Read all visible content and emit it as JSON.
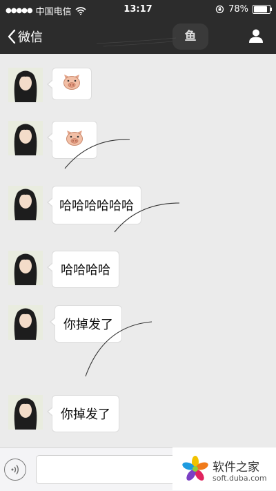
{
  "status_bar": {
    "signal_dots": "●●●●●",
    "carrier": "中国电信",
    "time": "13:17",
    "battery_percent": "78%",
    "battery_level": 0.78
  },
  "nav": {
    "back_label": "微信",
    "title_fragment": "鱼"
  },
  "messages": [
    {
      "type": "emoji",
      "icon": "pig-face-icon"
    },
    {
      "type": "emoji",
      "icon": "pig-face-icon"
    },
    {
      "type": "text",
      "text": "哈哈哈哈哈哈"
    },
    {
      "type": "text",
      "text": "哈哈哈哈"
    },
    {
      "type": "text",
      "text": "你掉发了"
    },
    {
      "type": "text",
      "text": "你掉发了"
    }
  ],
  "input_bar": {
    "voice_icon": "voice-wave-icon",
    "input_value": ""
  },
  "watermark": {
    "title": "软件之家",
    "subtitle": "soft.duba.com"
  }
}
